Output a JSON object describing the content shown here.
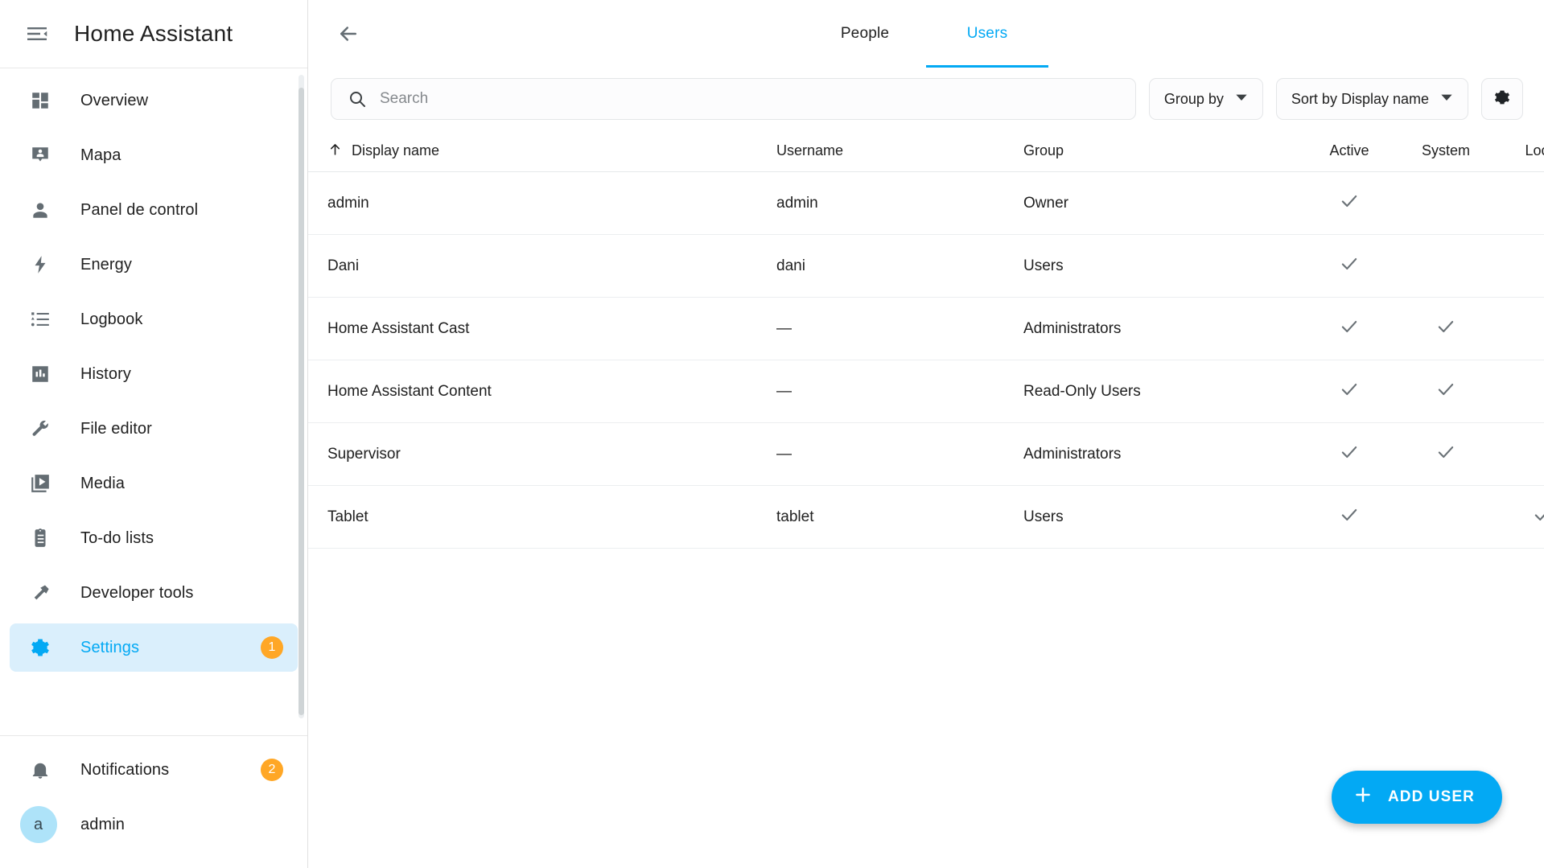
{
  "sidebar": {
    "title": "Home Assistant",
    "menu_icon": "menu-collapse-icon",
    "items": [
      {
        "label": "Overview",
        "icon": "view-dashboard-icon",
        "badge": null,
        "active": false
      },
      {
        "label": "Mapa",
        "icon": "map-marker-account-icon",
        "badge": null,
        "active": false
      },
      {
        "label": "Panel de control",
        "icon": "account-icon",
        "badge": null,
        "active": false
      },
      {
        "label": "Energy",
        "icon": "lightning-bolt-icon",
        "badge": null,
        "active": false
      },
      {
        "label": "Logbook",
        "icon": "format-list-bulleted-icon",
        "badge": null,
        "active": false
      },
      {
        "label": "History",
        "icon": "chart-box-icon",
        "badge": null,
        "active": false
      },
      {
        "label": "File editor",
        "icon": "wrench-icon",
        "badge": null,
        "active": false
      },
      {
        "label": "Media",
        "icon": "play-box-multiple-icon",
        "badge": null,
        "active": false
      },
      {
        "label": "To-do lists",
        "icon": "clipboard-list-icon",
        "badge": null,
        "active": false
      },
      {
        "label": "Developer tools",
        "icon": "hammer-icon",
        "badge": null,
        "active": false
      },
      {
        "label": "Settings",
        "icon": "cog-icon",
        "badge": "1",
        "active": true
      }
    ],
    "footer": {
      "notifications": {
        "label": "Notifications",
        "icon": "bell-icon",
        "badge": "2"
      },
      "user": {
        "label": "admin",
        "avatar_letter": "a"
      }
    }
  },
  "header": {
    "back_icon": "arrow-left-icon",
    "tabs": [
      {
        "label": "People",
        "active": false
      },
      {
        "label": "Users",
        "active": true
      }
    ]
  },
  "toolbar": {
    "search": {
      "placeholder": "Search",
      "value": "",
      "icon": "search-icon"
    },
    "group_by": {
      "label": "Group by",
      "icon": "chevron-down-icon"
    },
    "sort_by": {
      "label": "Sort by Display name",
      "icon": "chevron-down-icon"
    },
    "settings_button": {
      "icon": "gear-icon"
    }
  },
  "table": {
    "sort_indicator": "arrow-up-icon",
    "columns": [
      "Display name",
      "Username",
      "Group",
      "Active",
      "System",
      "Local"
    ],
    "rows": [
      {
        "display_name": "admin",
        "username": "admin",
        "group": "Owner",
        "active": true,
        "system": false,
        "local": false
      },
      {
        "display_name": "Dani",
        "username": "dani",
        "group": "Users",
        "active": true,
        "system": false,
        "local": false
      },
      {
        "display_name": "Home Assistant Cast",
        "username": "—",
        "group": "Administrators",
        "active": true,
        "system": true,
        "local": false
      },
      {
        "display_name": "Home Assistant Content",
        "username": "—",
        "group": "Read-Only Users",
        "active": true,
        "system": true,
        "local": false
      },
      {
        "display_name": "Supervisor",
        "username": "—",
        "group": "Administrators",
        "active": true,
        "system": true,
        "local": false
      },
      {
        "display_name": "Tablet",
        "username": "tablet",
        "group": "Users",
        "active": true,
        "system": false,
        "local": true
      }
    ]
  },
  "fab": {
    "label": "ADD USER",
    "icon": "plus-icon"
  },
  "colors": {
    "accent": "#03a9f4",
    "badge": "#ffa726",
    "active_bg": "#daeffc",
    "avatar_bg": "#aee3f9",
    "text": "#212121",
    "icon": "#646d73"
  }
}
